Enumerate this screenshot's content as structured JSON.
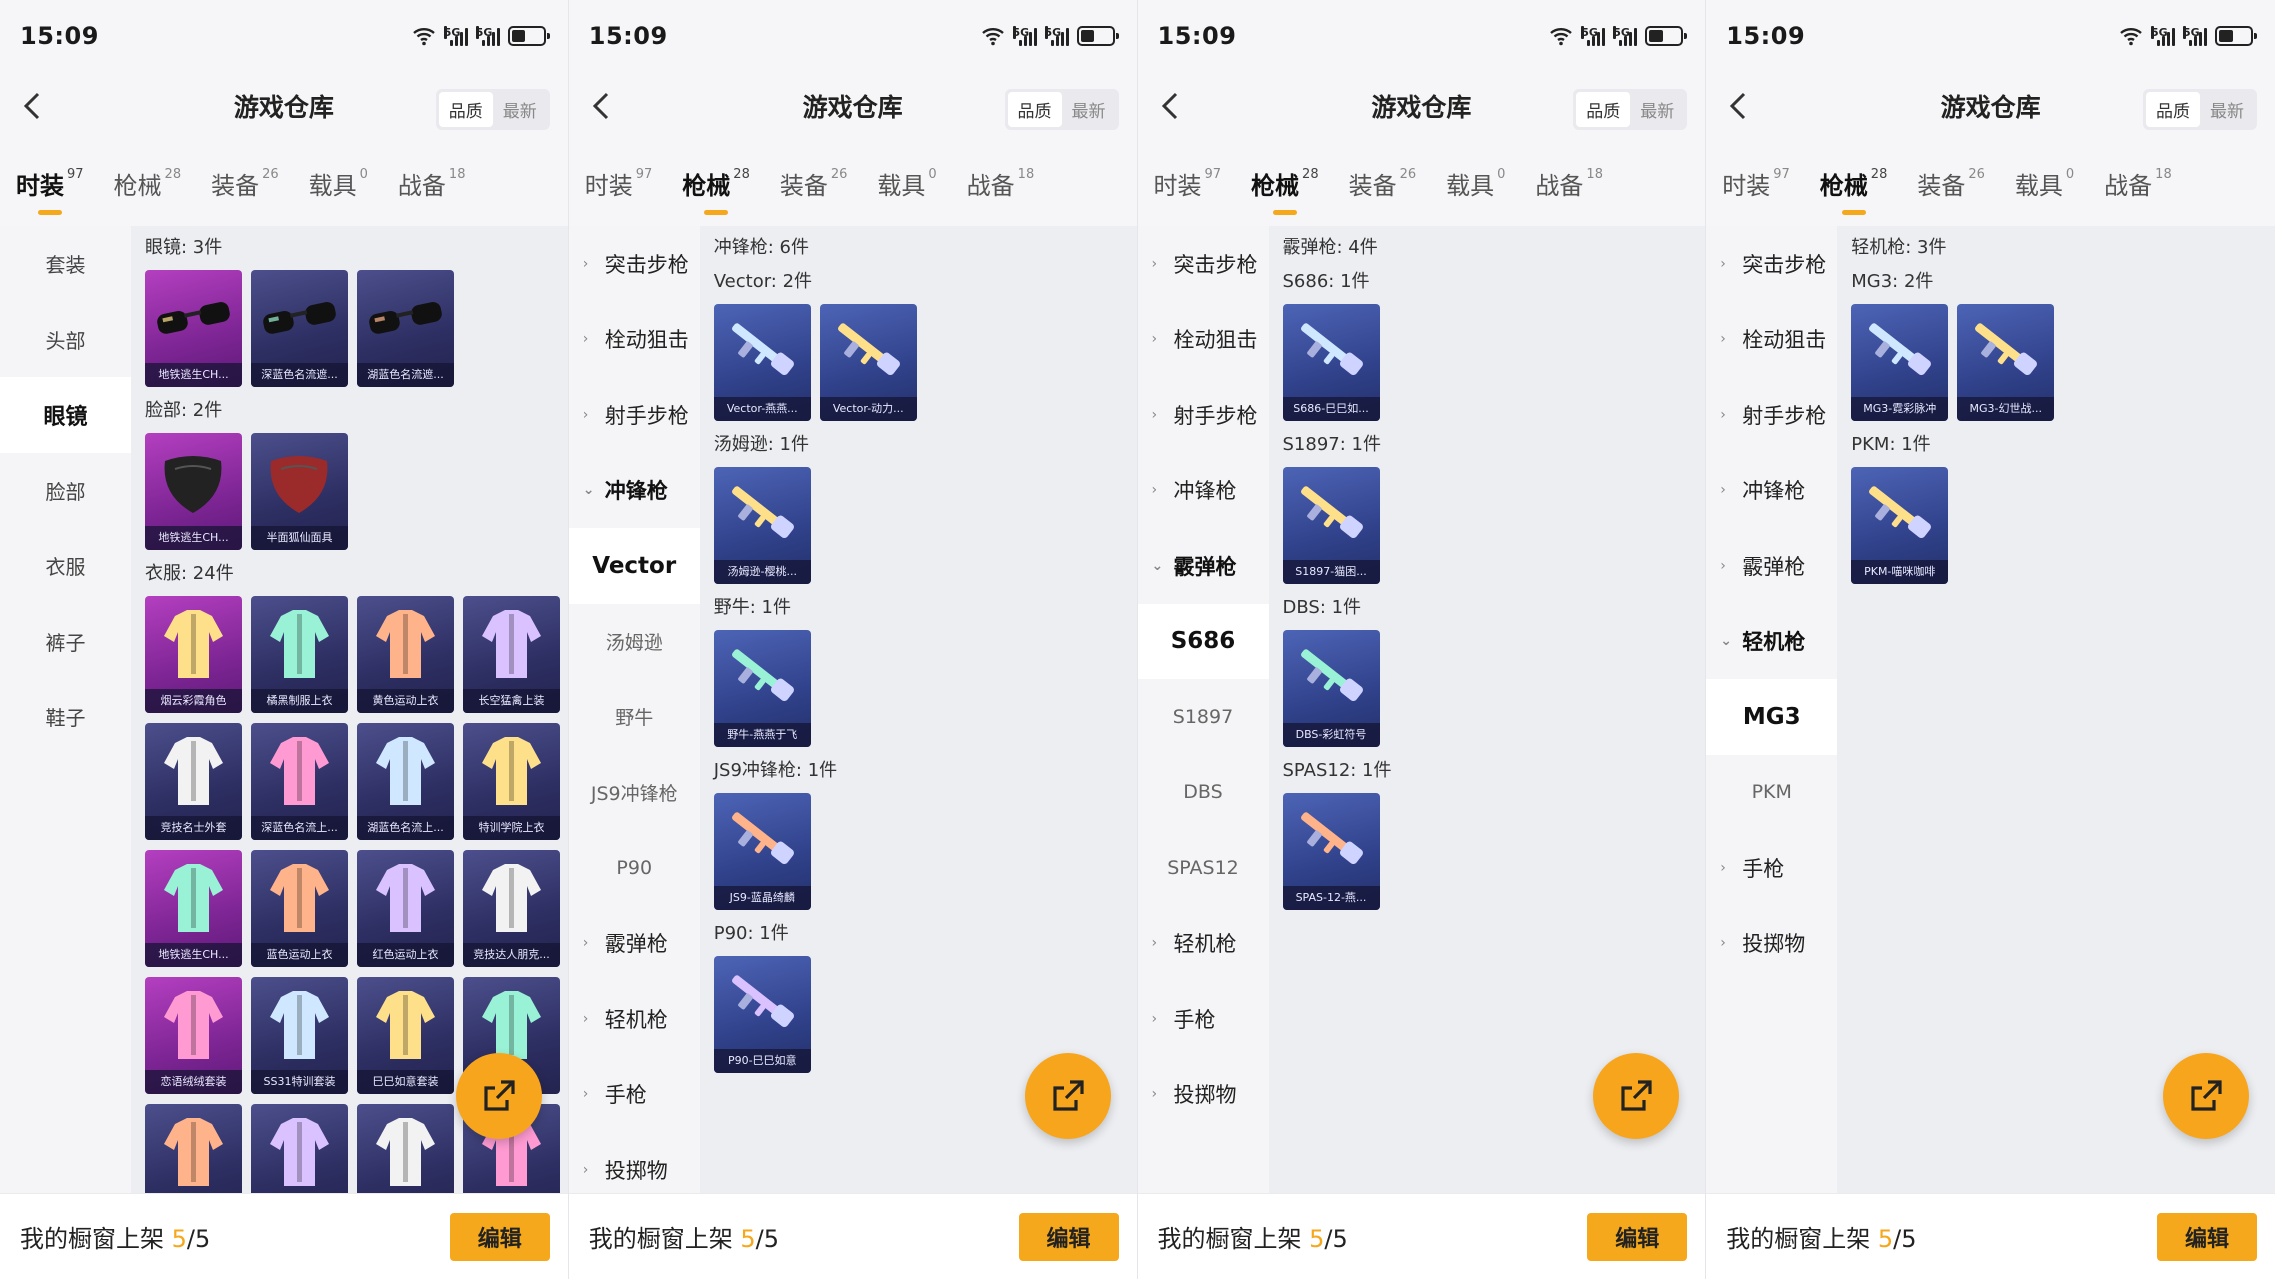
{
  "status": {
    "time": "15:09",
    "net1": "5G",
    "net2": "5G"
  },
  "header": {
    "title": "游戏仓库",
    "sort_quality": "品质",
    "sort_newest": "最新"
  },
  "tabs": [
    {
      "label": "时装",
      "count": "97"
    },
    {
      "label": "枪械",
      "count": "28"
    },
    {
      "label": "装备",
      "count": "26"
    },
    {
      "label": "载具",
      "count": "0"
    },
    {
      "label": "战备",
      "count": "18"
    }
  ],
  "footer": {
    "label": "我的橱窗上架",
    "count": "5",
    "total": "/5",
    "edit": "编辑"
  },
  "fashion_sidebar": [
    "套装",
    "头部",
    "眼镜",
    "脸部",
    "衣服",
    "裤子",
    "鞋子"
  ],
  "weapon_groups": {
    "assault": "突击步枪",
    "bolt": "栓动狙击",
    "marksman": "射手步枪",
    "smg": "冲锋枪",
    "shotgun": "霰弹枪",
    "lmg": "轻机枪",
    "pistol": "手枪",
    "throw": "投掷物"
  },
  "smg_subs": [
    "Vector",
    "汤姆逊",
    "野牛",
    "JS9冲锋枪",
    "P90"
  ],
  "shotgun_subs": [
    "S686",
    "S1897",
    "DBS",
    "SPAS12"
  ],
  "lmg_subs": [
    "MG3",
    "PKM"
  ],
  "panel1": {
    "sections": [
      {
        "label": "眼镜: 3件",
        "items": [
          "地铁逃生CH...",
          "深蓝色名流遮...",
          "湖蓝色名流遮..."
        ]
      },
      {
        "label": "脸部: 2件",
        "items": [
          "地铁逃生CH...",
          "半面狐仙面具"
        ]
      },
      {
        "label": "衣服: 24件",
        "items": [
          "烟云彩霞角色",
          "橘黑制服上衣",
          "黄色运动上衣",
          "长空猛禽上装",
          "竞技名士外套",
          "深蓝色名流上...",
          "湖蓝色名流上...",
          "特训学院上衣",
          "地铁逃生CH...",
          "蓝色运动上衣",
          "红色运动上衣",
          "竞技达人朋克...",
          "恋语绒绒套装",
          "SS31特训套装",
          "巳巳如意套装",
          "",
          "",
          "",
          "",
          ""
        ]
      }
    ]
  },
  "panel2": {
    "sections": [
      {
        "label": "冲锋枪: 6件"
      },
      {
        "label": "Vector: 2件",
        "items": [
          "Vector-燕燕...",
          "Vector-动力..."
        ]
      },
      {
        "label": "汤姆逊: 1件",
        "items": [
          "汤姆逊-樱桃..."
        ]
      },
      {
        "label": "野牛: 1件",
        "items": [
          "野牛-燕燕于飞"
        ]
      },
      {
        "label": "JS9冲锋枪: 1件",
        "items": [
          "JS9-蓝晶绮麟"
        ]
      },
      {
        "label": "P90: 1件",
        "items": [
          "P90-巳巳如意"
        ]
      }
    ]
  },
  "panel3": {
    "sections": [
      {
        "label": "霰弹枪: 4件"
      },
      {
        "label": "S686: 1件",
        "items": [
          "S686-巳巳如..."
        ]
      },
      {
        "label": "S1897: 1件",
        "items": [
          "S1897-猫困..."
        ]
      },
      {
        "label": "DBS: 1件",
        "items": [
          "DBS-彩虹符号"
        ]
      },
      {
        "label": "SPAS12: 1件",
        "items": [
          "SPAS-12-燕..."
        ]
      }
    ]
  },
  "panel4": {
    "sections": [
      {
        "label": "轻机枪: 3件"
      },
      {
        "label": "MG3: 2件",
        "items": [
          "MG3-霓彩脉冲",
          "MG3-幻世战..."
        ]
      },
      {
        "label": "PKM: 1件",
        "items": [
          "PKM-喵咪咖啡"
        ]
      }
    ]
  }
}
